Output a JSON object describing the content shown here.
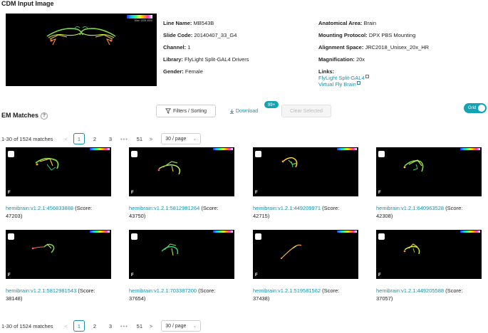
{
  "cdm": {
    "title": "CDM Input Image",
    "image_scale_label": "Max: 1326 4000",
    "meta_left": [
      {
        "key": "Line Name:",
        "value": "MB543B"
      },
      {
        "key": "Slide Code:",
        "value": "20140407_33_G4"
      },
      {
        "key": "Channel:",
        "value": "1"
      },
      {
        "key": "Library:",
        "value": "FlyLight Split-GAL4 Drivers"
      },
      {
        "key": "Gender:",
        "value": "Female"
      }
    ],
    "meta_right": [
      {
        "key": "Anatomical Area:",
        "value": "Brain"
      },
      {
        "key": "Mounting Protocol:",
        "value": "DPX PBS Mounting"
      },
      {
        "key": "Alignment Space:",
        "value": "JRC2018_Unisex_20x_HR"
      },
      {
        "key": "Magnification:",
        "value": "20x"
      }
    ],
    "links_label": "Links:",
    "links": [
      "FlyLight Split-GAL4",
      "Virtual Fly Brain"
    ]
  },
  "em": {
    "title": "EM Matches",
    "help": "?",
    "filter_label": "Filters / Sorting",
    "download_label": "Download",
    "download_badge": "99+",
    "clear_label": "Clear Selected",
    "toggle_label": "Grid"
  },
  "pagination": {
    "total": "1-30 of 1524 matches",
    "pages": [
      "1",
      "2",
      "3",
      "51"
    ],
    "dots": "•••",
    "prev": "<",
    "next": ">",
    "page_size": "30 / page"
  },
  "results": [
    {
      "id": "hemibrain:v1.2.1:456833888",
      "score_open": " (Score:",
      "score": "47203)",
      "flag": "F"
    },
    {
      "id": "hemibrain:v1.2.1:5812981264",
      "score_open": " (Score:",
      "score": "43750)",
      "flag": "F"
    },
    {
      "id": "hemibrain:v1.2.1:449209971",
      "score_open": " (Score:",
      "score": "42715)",
      "flag": "F"
    },
    {
      "id": "hemibrain:v1.2.1:640963528",
      "score_open": " (Score:",
      "score": "42308)",
      "flag": "F"
    },
    {
      "id": "hemibrain:v1.2.1:5812981543",
      "score_open": " (Score:",
      "score": "38148)",
      "flag": "F"
    },
    {
      "id": "hemibrain:v1.2.1:703387200",
      "score_open": " (Score:",
      "score": "37654)",
      "flag": "F"
    },
    {
      "id": "hemibrain:v1.2.1:519581562",
      "score_open": " (Score:",
      "score": "37438)",
      "flag": "F"
    },
    {
      "id": "hemibrain:v1.2.1:449205588",
      "score_open": " (Score:",
      "score": "37057)",
      "flag": "F"
    }
  ]
}
